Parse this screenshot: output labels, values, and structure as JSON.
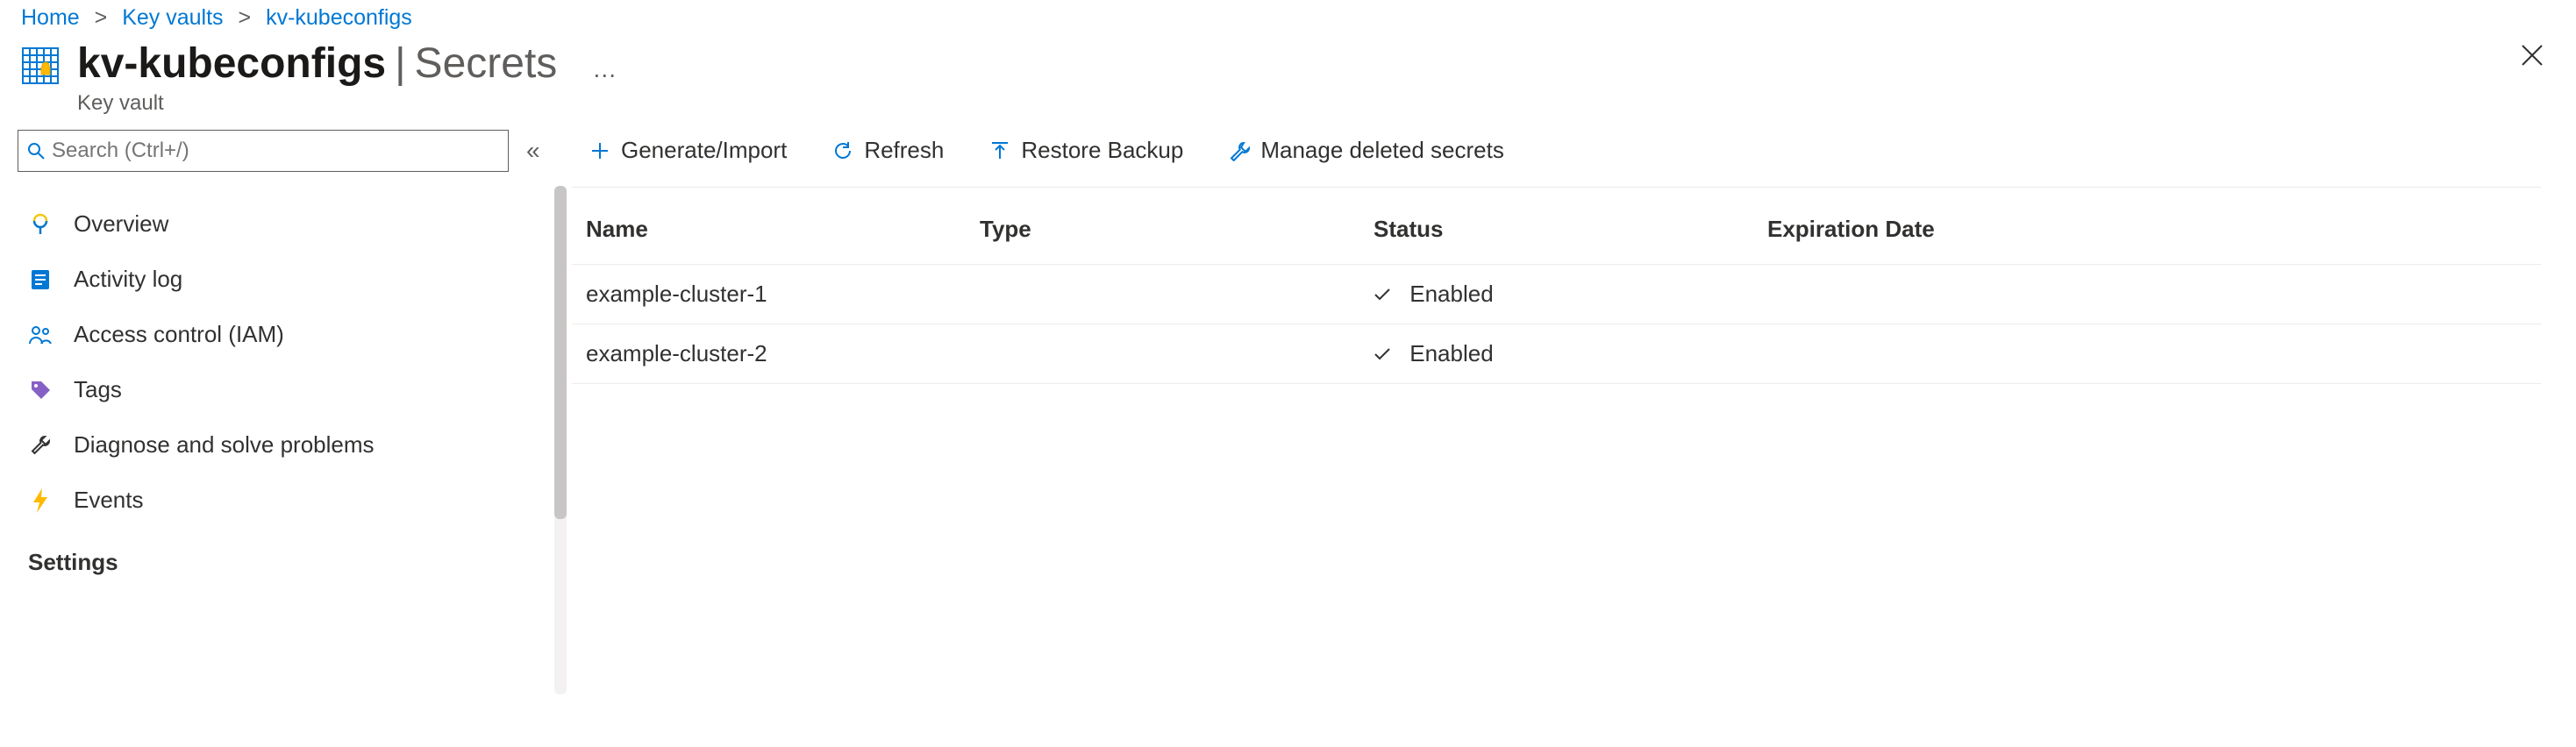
{
  "breadcrumb": {
    "home": "Home",
    "vaults": "Key vaults",
    "current": "kv-kubeconfigs"
  },
  "header": {
    "title": "kv-kubeconfigs",
    "section": "Secrets",
    "subtitle": "Key vault",
    "ellipsis": "…"
  },
  "sidebar": {
    "search_placeholder": "Search (Ctrl+/)",
    "items": {
      "overview": "Overview",
      "activity": "Activity log",
      "iam": "Access control (IAM)",
      "tags": "Tags",
      "diagnose": "Diagnose and solve problems",
      "events": "Events"
    },
    "heading_settings": "Settings"
  },
  "toolbar": {
    "generate": "Generate/Import",
    "refresh": "Refresh",
    "restore": "Restore Backup",
    "manage_deleted": "Manage deleted secrets"
  },
  "table": {
    "columns": {
      "name": "Name",
      "type": "Type",
      "status": "Status",
      "expiration": "Expiration Date"
    },
    "rows": [
      {
        "name": "example-cluster-1",
        "type": "",
        "status": "Enabled",
        "expiration": ""
      },
      {
        "name": "example-cluster-2",
        "type": "",
        "status": "Enabled",
        "expiration": ""
      }
    ]
  }
}
